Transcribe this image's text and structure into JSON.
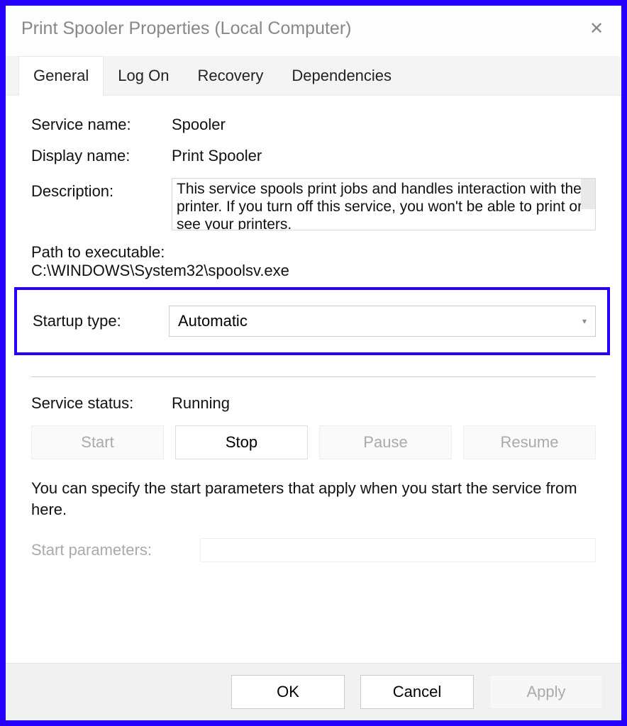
{
  "title": "Print Spooler Properties (Local Computer)",
  "tabs": {
    "general": "General",
    "logon": "Log On",
    "recovery": "Recovery",
    "dependencies": "Dependencies"
  },
  "labels": {
    "service_name": "Service name:",
    "display_name": "Display name:",
    "description": "Description:",
    "path_to_exe": "Path to executable:",
    "startup_type": "Startup type:",
    "service_status": "Service status:",
    "start_params": "Start parameters:"
  },
  "values": {
    "service_name": "Spooler",
    "display_name": "Print Spooler",
    "description": "This service spools print jobs and handles interaction with the printer.  If you turn off this service, you won't be able to print or see your printers.",
    "exe_path": "C:\\WINDOWS\\System32\\spoolsv.exe",
    "startup_type": "Automatic",
    "service_status": "Running",
    "start_params": ""
  },
  "buttons": {
    "start": "Start",
    "stop": "Stop",
    "pause": "Pause",
    "resume": "Resume",
    "ok": "OK",
    "cancel": "Cancel",
    "apply": "Apply"
  },
  "note": "You can specify the start parameters that apply when you start the service from here."
}
